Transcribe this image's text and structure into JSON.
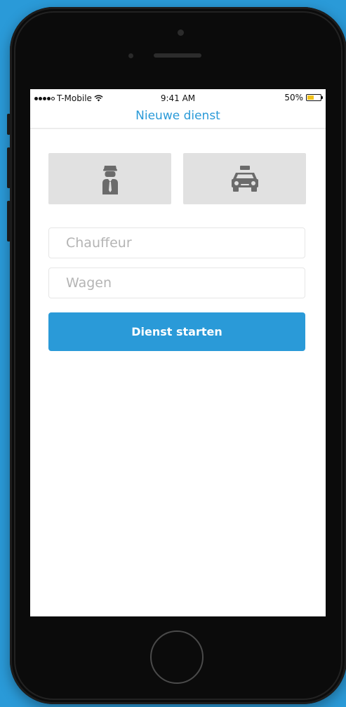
{
  "status_bar": {
    "carrier": "T-Mobile",
    "time": "9:41 AM",
    "battery": "50%",
    "battery_level": 0.5,
    "signal_dots_filled": 4,
    "signal_dots_total": 5
  },
  "nav": {
    "title": "Nieuwe dienst"
  },
  "tiles": [
    {
      "icon": "chauffeur-icon"
    },
    {
      "icon": "taxi-icon"
    }
  ],
  "form": {
    "chauffeur_placeholder": "Chauffeur",
    "wagen_placeholder": "Wagen",
    "submit_label": "Dienst starten"
  },
  "colors": {
    "accent": "#2a9ad8",
    "tile_background": "#e1e1e1",
    "icon": "#6b6b6b",
    "battery": "#f2c21b"
  }
}
